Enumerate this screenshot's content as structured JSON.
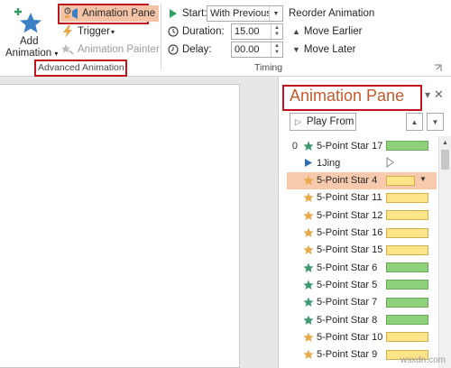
{
  "ribbon": {
    "add_animation": {
      "line1": "Add",
      "line2": "Animation",
      "arrow": "▾"
    },
    "animation_pane_btn": "Animation Pane",
    "trigger_btn": "Trigger",
    "trigger_arrow": "▾",
    "animation_painter_btn": "Animation Painter",
    "advanced_group_label": "Advanced Animation",
    "start_label": "Start:",
    "start_value": "With Previous",
    "duration_label": "Duration:",
    "duration_value": "15.00",
    "delay_label": "Delay:",
    "delay_value": "00.00",
    "timing_group_label": "Timing",
    "reorder_title": "Reorder Animation",
    "move_earlier": "Move Earlier",
    "move_later": "Move Later",
    "highlight_color": "#c0131b"
  },
  "pane": {
    "title": "Animation Pane",
    "dropdown_icon": "▾",
    "close_icon": "✕",
    "play_from": "Play From",
    "items": [
      {
        "num": "0",
        "icon": "star-green",
        "label": "5-Point Star 17",
        "bar": "green",
        "selected": false
      },
      {
        "num": "",
        "icon": "play-blue",
        "label": "1Jing",
        "bar": "trigger",
        "selected": false
      },
      {
        "num": "",
        "icon": "star-gold",
        "label": "5-Point Star 4",
        "bar": "yellow",
        "selected": true
      },
      {
        "num": "",
        "icon": "star-gold",
        "label": "5-Point Star 11",
        "bar": "yellow",
        "selected": false
      },
      {
        "num": "",
        "icon": "star-gold",
        "label": "5-Point Star 12",
        "bar": "yellow",
        "selected": false
      },
      {
        "num": "",
        "icon": "star-gold",
        "label": "5-Point Star 16",
        "bar": "yellow",
        "selected": false
      },
      {
        "num": "",
        "icon": "star-gold",
        "label": "5-Point Star 15",
        "bar": "yellow",
        "selected": false
      },
      {
        "num": "",
        "icon": "star-green",
        "label": "5-Point Star 6",
        "bar": "green",
        "selected": false
      },
      {
        "num": "",
        "icon": "star-green",
        "label": "5-Point Star 5",
        "bar": "green",
        "selected": false
      },
      {
        "num": "",
        "icon": "star-green",
        "label": "5-Point Star 7",
        "bar": "green",
        "selected": false
      },
      {
        "num": "",
        "icon": "star-green",
        "label": "5-Point Star 8",
        "bar": "green",
        "selected": false
      },
      {
        "num": "",
        "icon": "star-gold",
        "label": "5-Point Star 10",
        "bar": "yellow",
        "selected": false
      },
      {
        "num": "",
        "icon": "star-gold",
        "label": "5-Point Star 9",
        "bar": "yellow",
        "selected": false
      }
    ]
  },
  "colors": {
    "accent_title": "#c55a2b",
    "selected_row": "#f7c9ad",
    "green_bar": "#8fd17a",
    "yellow_bar": "#ffe48a",
    "star_green": "#3f9a72",
    "star_gold": "#e9a84a"
  },
  "watermark": "wsxdn.com"
}
